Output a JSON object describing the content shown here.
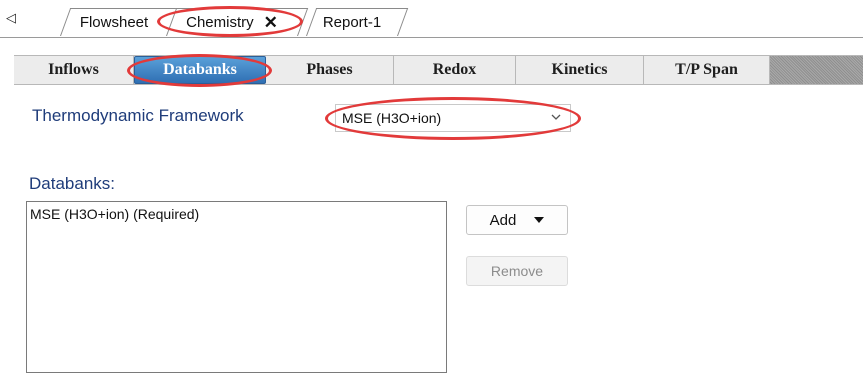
{
  "doc_tabs": {
    "nav_arrow": "◁",
    "tabs": [
      {
        "label": "Flowsheet"
      },
      {
        "label": "Chemistry",
        "close": "✕"
      },
      {
        "label": "Report-1"
      }
    ]
  },
  "inner_tabs": [
    {
      "label": "Inflows"
    },
    {
      "label": "Databanks"
    },
    {
      "label": "Phases"
    },
    {
      "label": "Redox"
    },
    {
      "label": "Kinetics"
    },
    {
      "label": "T/P Span"
    }
  ],
  "framework": {
    "label": "Thermodynamic Framework",
    "selected": "MSE (H3O+ion)"
  },
  "databanks": {
    "label": "Databanks:",
    "items": [
      "MSE (H3O+ion) (Required)"
    ],
    "add_label": "Add",
    "remove_label": "Remove"
  },
  "colors": {
    "annotation": "#e23a3a",
    "label_text": "#1f3c7a",
    "active_tab": "#3a7fc6"
  },
  "icons": {
    "nav": "triangle-left-icon",
    "close": "close-icon",
    "dropdown": "chevron-down-icon",
    "add_menu": "caret-down-icon"
  }
}
